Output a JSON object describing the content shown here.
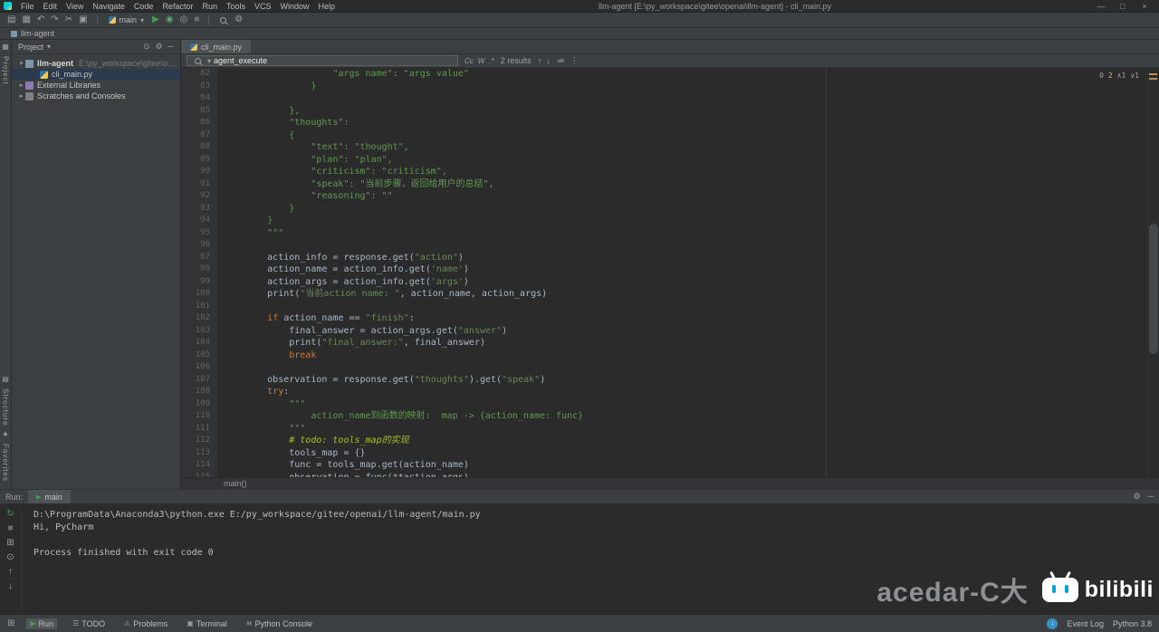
{
  "colors": {
    "bg-editor": "#2b2b2b",
    "bg-panel": "#3c3f41",
    "bg-gutter": "#313335",
    "bg-tab-active": "#4e5254",
    "ui-text": "#bbbbbb",
    "code-text": "#a9b7c6",
    "string-green": "#6a8759",
    "doc-green": "#629755",
    "keyword-orange": "#cc7832",
    "todo-yellow": "#a8c023",
    "line-number": "#606366",
    "run-green": "#499c54",
    "warn-orange": "#d5b778",
    "badge-blue": "#3592c4",
    "path-gray": "#787878"
  },
  "titlebar": {
    "menus": [
      "File",
      "Edit",
      "View",
      "Navigate",
      "Code",
      "Refactor",
      "Run",
      "Tools",
      "VCS",
      "Window",
      "Help"
    ],
    "title": "llm-agent [E:\\py_workspace\\gitee\\openai\\llm-agent] - cli_main.py",
    "controls": [
      {
        "name": "minimize-button",
        "glyph": "—"
      },
      {
        "name": "maximize-button",
        "glyph": "□"
      },
      {
        "name": "close-button",
        "glyph": "×"
      }
    ]
  },
  "toolbar": {
    "icons_left": [
      {
        "name": "open-icon",
        "glyph": "▤"
      },
      {
        "name": "save-all-icon",
        "glyph": "▦"
      },
      {
        "name": "undo-icon",
        "glyph": "↶"
      },
      {
        "name": "redo-icon",
        "glyph": "↷"
      },
      {
        "name": "cut-icon",
        "glyph": "✂"
      },
      {
        "name": "copy-icon",
        "glyph": "▣"
      }
    ],
    "run_config": "main",
    "run_controls": [
      {
        "name": "run-button",
        "glyph": "▶",
        "color": "#499c54"
      },
      {
        "name": "debug-button",
        "glyph": "◉",
        "color": "#59a869"
      },
      {
        "name": "coverage-button",
        "glyph": "◎",
        "color": "#9da0a2"
      },
      {
        "name": "stop-button",
        "glyph": "■",
        "color": "#6e6e6e"
      }
    ],
    "settings_icon": "⚙"
  },
  "navbar": {
    "crumb": "llm-agent"
  },
  "left_stripe": {
    "top": [
      {
        "id": "project",
        "label": "Project",
        "icon": "▦"
      }
    ],
    "bottom": [
      {
        "id": "structure",
        "label": "Structure",
        "icon": "▤"
      },
      {
        "id": "favorites",
        "label": "Favorites",
        "icon": "★"
      }
    ]
  },
  "project_panel": {
    "header": "Project",
    "header_caret": "▾",
    "header_icons": [
      {
        "id": "locate",
        "glyph": "⊙"
      },
      {
        "id": "settings",
        "glyph": "⚙"
      },
      {
        "id": "hide",
        "glyph": "─"
      }
    ],
    "tree": [
      {
        "id": "llm-agent-root",
        "label": "llm-agent",
        "path": "E:\\py_workspace\\gitee\\openai\\llm-agent",
        "level": 0,
        "icon": "folder",
        "arrow": "▾",
        "root": true
      },
      {
        "id": "cli-main-py",
        "label": "cli_main.py",
        "path": "",
        "level": 1,
        "icon": "python",
        "arrow": "",
        "selected": true
      },
      {
        "id": "external-libraries",
        "label": "External Libraries",
        "path": "",
        "level": 0,
        "icon": "library",
        "arrow": "▸"
      },
      {
        "id": "scratches-and-consoles",
        "label": "Scratches and Consoles",
        "path": "",
        "level": 0,
        "icon": "scratch",
        "arrow": "▸"
      }
    ]
  },
  "editor": {
    "tab": "cli_main.py",
    "search": {
      "query": "agent_execute",
      "results": "2 results",
      "toggles": [
        {
          "id": "match-case",
          "glyph": "Cc"
        },
        {
          "id": "words",
          "glyph": "W"
        },
        {
          "id": "regex",
          "glyph": ".*"
        }
      ],
      "nav": [
        {
          "id": "prev-occurrence",
          "glyph": "↑"
        },
        {
          "id": "next-occurrence",
          "glyph": "↓"
        }
      ],
      "extra": [
        {
          "id": "filter",
          "glyph": "≔"
        },
        {
          "id": "more-options",
          "glyph": "⋮"
        }
      ]
    },
    "inspections": {
      "errors": "0",
      "warnings": "2",
      "up": "∧1",
      "down": "∨1"
    },
    "breadcrumb": "main()",
    "lines": [
      {
        "n": 82,
        "s": [
          [
            "                    \"args name\": \"args value\"",
            "doc"
          ]
        ]
      },
      {
        "n": 83,
        "s": [
          [
            "                }",
            "doc"
          ]
        ]
      },
      {
        "n": 84,
        "s": []
      },
      {
        "n": 85,
        "s": [
          [
            "            },",
            "doc"
          ]
        ]
      },
      {
        "n": 86,
        "s": [
          [
            "            \"thoughts\":",
            "doc"
          ]
        ]
      },
      {
        "n": 87,
        "s": [
          [
            "            {",
            "doc"
          ]
        ]
      },
      {
        "n": 88,
        "s": [
          [
            "                \"text\": \"thought\",",
            "doc"
          ]
        ]
      },
      {
        "n": 89,
        "s": [
          [
            "                \"plan\": \"plan\",",
            "doc"
          ]
        ]
      },
      {
        "n": 90,
        "s": [
          [
            "                \"criticism\": \"criticism\",",
            "doc"
          ]
        ]
      },
      {
        "n": 91,
        "s": [
          [
            "                \"speak\": \"当前步骤，返回给用户的总结\",",
            "doc"
          ]
        ]
      },
      {
        "n": 92,
        "s": [
          [
            "                \"reasoning\": \"\"",
            "doc"
          ]
        ]
      },
      {
        "n": 93,
        "s": [
          [
            "            }",
            "doc"
          ]
        ]
      },
      {
        "n": 94,
        "s": [
          [
            "        }",
            "doc"
          ]
        ]
      },
      {
        "n": 95,
        "s": [
          [
            "        \"\"\"",
            "doc"
          ]
        ]
      },
      {
        "n": 96,
        "s": []
      },
      {
        "n": 97,
        "s": [
          [
            "        action_info = response.get(",
            "pl"
          ],
          [
            "\"action\"",
            "str"
          ],
          [
            ")",
            "pl"
          ]
        ]
      },
      {
        "n": 98,
        "s": [
          [
            "        action_name = action_info.get(",
            "pl"
          ],
          [
            "'name'",
            "str"
          ],
          [
            ")",
            "pl"
          ]
        ]
      },
      {
        "n": 99,
        "s": [
          [
            "        action_args = action_info.get(",
            "pl"
          ],
          [
            "'args'",
            "str"
          ],
          [
            ")",
            "pl"
          ]
        ]
      },
      {
        "n": 100,
        "s": [
          [
            "        print(",
            "pl"
          ],
          [
            "\"当前action name: \"",
            "str"
          ],
          [
            ", action_name, action_args)",
            "pl"
          ]
        ]
      },
      {
        "n": 101,
        "s": []
      },
      {
        "n": 102,
        "s": [
          [
            "        ",
            "pl"
          ],
          [
            "if ",
            "kw"
          ],
          [
            "action_name == ",
            "pl"
          ],
          [
            "\"finish\"",
            "str"
          ],
          [
            ":",
            "pl"
          ]
        ]
      },
      {
        "n": 103,
        "s": [
          [
            "            final_answer = action_args.get(",
            "pl"
          ],
          [
            "\"answer\"",
            "str"
          ],
          [
            ")",
            "pl"
          ]
        ]
      },
      {
        "n": 104,
        "s": [
          [
            "            print(",
            "pl"
          ],
          [
            "\"final_answer:\"",
            "str"
          ],
          [
            ", final_answer)",
            "pl"
          ]
        ]
      },
      {
        "n": 105,
        "s": [
          [
            "            ",
            "pl"
          ],
          [
            "break",
            "kw"
          ]
        ]
      },
      {
        "n": 106,
        "s": []
      },
      {
        "n": 107,
        "s": [
          [
            "        observation = response.get(",
            "pl"
          ],
          [
            "\"thoughts\"",
            "str"
          ],
          [
            ").get(",
            "pl"
          ],
          [
            "\"speak\"",
            "str"
          ],
          [
            ")",
            "pl"
          ]
        ]
      },
      {
        "n": 108,
        "s": [
          [
            "        ",
            "pl"
          ],
          [
            "try",
            "kw"
          ],
          [
            ":",
            "pl"
          ]
        ]
      },
      {
        "n": 109,
        "s": [
          [
            "            \"\"\"",
            "doc"
          ]
        ]
      },
      {
        "n": 110,
        "s": [
          [
            "                action_name到函数的映射:  map -> {action_name: func}",
            "doc"
          ]
        ]
      },
      {
        "n": 111,
        "s": [
          [
            "            \"\"\"",
            "doc"
          ]
        ]
      },
      {
        "n": 112,
        "s": [
          [
            "            ",
            "pl"
          ],
          [
            "# todo: tools_map的实现",
            "todo"
          ]
        ]
      },
      {
        "n": 113,
        "s": [
          [
            "            tools_map = {}",
            "pl"
          ]
        ]
      },
      {
        "n": 114,
        "s": [
          [
            "            func = tools_map.get(action_name)",
            "pl"
          ]
        ]
      },
      {
        "n": 115,
        "s": [
          [
            "            observation = func(**action_args)",
            "pl"
          ]
        ]
      }
    ]
  },
  "run_panel": {
    "label": "Run:",
    "tab": "main",
    "header_icons": [
      {
        "id": "settings",
        "glyph": "⚙"
      },
      {
        "id": "hide",
        "glyph": "─"
      }
    ],
    "side_icons": [
      {
        "id": "rerun",
        "glyph": "↻",
        "color": "#499c54"
      },
      {
        "id": "stop",
        "glyph": "■",
        "color": "#6e6e6e"
      },
      {
        "id": "restore-layout",
        "glyph": "⊞",
        "color": ""
      },
      {
        "id": "pin",
        "glyph": "⊙",
        "color": ""
      },
      {
        "id": "scroll-up",
        "glyph": "↑",
        "color": ""
      },
      {
        "id": "scroll-down",
        "glyph": "↓",
        "color": ""
      }
    ],
    "console": [
      "D:\\ProgramData\\Anaconda3\\python.exe E:/py_workspace/gitee/openai/llm-agent/main.py",
      "Hi, PyCharm",
      "",
      "Process finished with exit code 0"
    ]
  },
  "statusbar": {
    "left": [
      {
        "id": "run",
        "label": "Run",
        "icon": "▶",
        "active": true
      },
      {
        "id": "todo",
        "label": "TODO",
        "icon": "☰",
        "active": false
      },
      {
        "id": "problems",
        "label": "Problems",
        "icon": "⚠",
        "active": false
      },
      {
        "id": "terminal",
        "label": "Terminal",
        "icon": "▣",
        "active": false
      },
      {
        "id": "python-console",
        "label": "Python Console",
        "icon": "≋",
        "active": false
      }
    ],
    "right": [
      {
        "id": "event-log",
        "label": "Event Log"
      },
      {
        "id": "python-interpreter",
        "label": "Python 3.8"
      }
    ]
  },
  "watermark": {
    "text": "acedar-C大",
    "logo_text": "bilibili"
  }
}
